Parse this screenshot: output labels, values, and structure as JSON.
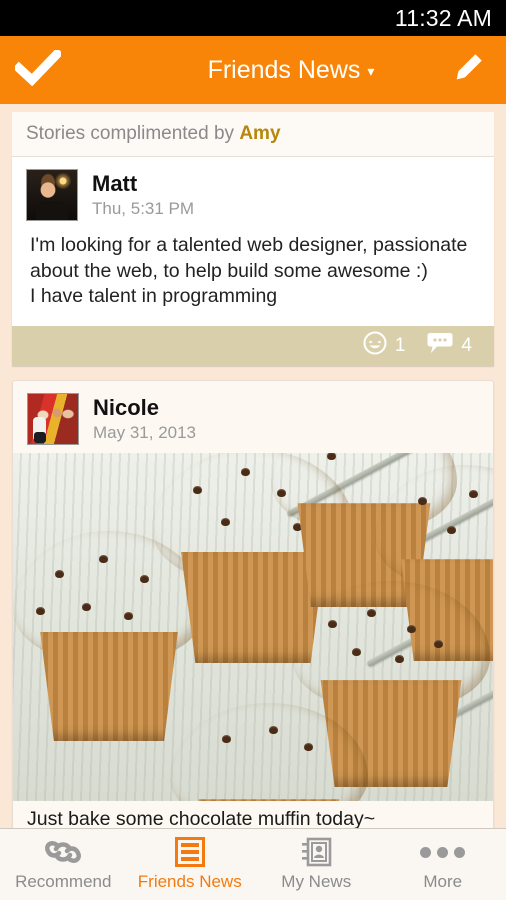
{
  "status_bar": {
    "time": "11:32 AM"
  },
  "action_bar": {
    "confirm_icon": "check-icon",
    "title": "Friends News",
    "caret": "▾",
    "compose_icon": "pencil-icon"
  },
  "section_header": {
    "prefix": "Stories complimented by ",
    "highlight": "Amy"
  },
  "posts": [
    {
      "author": "Matt",
      "timestamp": "Thu, 5:31 PM",
      "avatar_name": "avatar-matt",
      "text": "I'm looking for a talented web designer, passionate about the web, to help build some awesome :)\nI have talent in programming",
      "reactions": {
        "smile_icon": "smiley-icon",
        "smile_count": "1",
        "comment_icon": "comment-bubble-icon",
        "comment_count": "4"
      }
    },
    {
      "author": "Nicole",
      "timestamp": "May 31, 2013",
      "avatar_name": "avatar-nicole",
      "photo_alt": "chocolate chip muffins on a cooling rack",
      "caption": "Just bake some chocolate muffin today~"
    }
  ],
  "tabbar": {
    "items": [
      {
        "label": "Recommend",
        "icon": "link-chain-icon",
        "active": false
      },
      {
        "label": "Friends News",
        "icon": "list-lines-icon",
        "active": true
      },
      {
        "label": "My News",
        "icon": "address-book-icon",
        "active": false
      },
      {
        "label": "More",
        "icon": "ellipsis-icon",
        "active": false
      }
    ]
  },
  "colors": {
    "accent": "#f88508",
    "page_bg": "#fbe7d6",
    "post_footer": "#d9d0ab",
    "highlight_name": "#b8860b",
    "muted_text": "#9a9a9a"
  }
}
